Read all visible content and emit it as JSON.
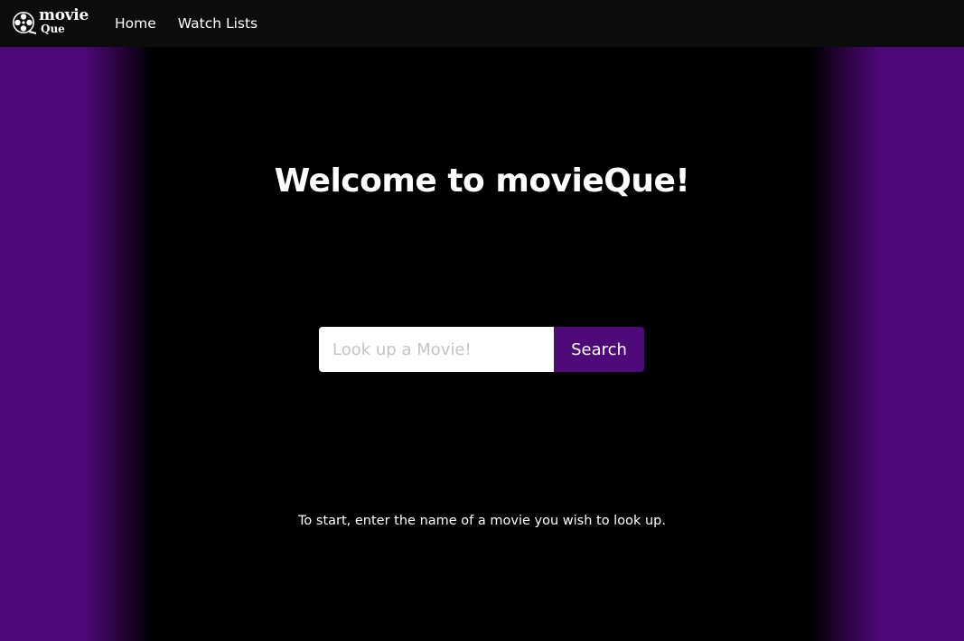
{
  "nav": {
    "logo": {
      "line1": "movie",
      "line2": "Que",
      "icon": "film-reel-icon"
    },
    "links": [
      {
        "label": "Home"
      },
      {
        "label": "Watch Lists"
      }
    ]
  },
  "main": {
    "title": "Welcome to movieQue!",
    "search": {
      "placeholder": "Look up a Movie!",
      "value": "",
      "button_label": "Search"
    },
    "hint": "To start, enter the name of a movie you wish to look up."
  },
  "colors": {
    "navbar": "#0c0c0c",
    "accent_purple": "#4e0878",
    "button_purple": "#4d0a78",
    "background": "#000000"
  }
}
